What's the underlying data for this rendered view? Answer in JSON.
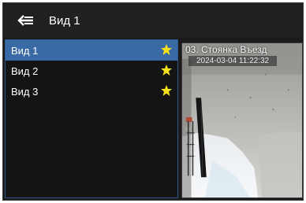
{
  "header": {
    "back_icon": "back-arrow-icon",
    "title": "Вид 1"
  },
  "sidebar": {
    "items": [
      {
        "label": "Вид 1",
        "selected": true,
        "favorite": true,
        "icon": "star-icon"
      },
      {
        "label": "Вид 2",
        "selected": false,
        "favorite": true,
        "icon": "star-icon"
      },
      {
        "label": "Вид 3",
        "selected": false,
        "favorite": true,
        "icon": "star-icon"
      }
    ]
  },
  "camera": {
    "title": "03. Стоянка Въезд",
    "timestamp": "2024-03-04 11:22:32"
  },
  "colors": {
    "accent": "#3a6aa5",
    "star": "#f5e11a",
    "background": "#1c1c1c"
  }
}
